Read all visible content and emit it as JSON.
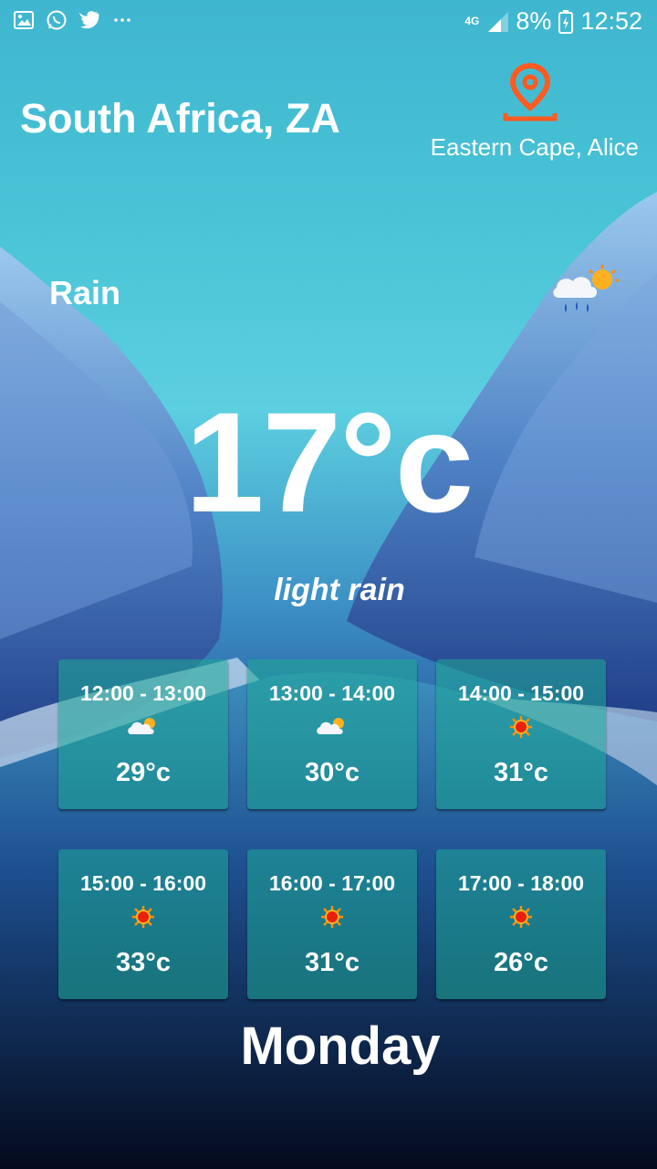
{
  "status_bar": {
    "left_icons": [
      "gallery-icon",
      "whatsapp-icon",
      "twitter-icon",
      "more-dots-icon"
    ],
    "network": "4G",
    "battery": "8%",
    "time": "12:52"
  },
  "location": {
    "country": "South Africa, ZA",
    "region": "Eastern Cape, Alice",
    "pin_icon": "location-pin-icon",
    "accent_color": "#FF5A1F"
  },
  "current": {
    "condition": "Rain",
    "icon": "rain-sun-icon",
    "temperature": "17°c",
    "description": "light rain"
  },
  "hourly": [
    {
      "time": "12:00 - 13:00",
      "icon": "partly-cloudy-icon",
      "temp": "29°c"
    },
    {
      "time": "13:00 - 14:00",
      "icon": "partly-cloudy-icon",
      "temp": "30°c"
    },
    {
      "time": "14:00 - 15:00",
      "icon": "sun-icon",
      "temp": "31°c"
    },
    {
      "time": "15:00 - 16:00",
      "icon": "sun-icon",
      "temp": "33°c"
    },
    {
      "time": "16:00 - 17:00",
      "icon": "sun-icon",
      "temp": "31°c"
    },
    {
      "time": "17:00 - 18:00",
      "icon": "sun-icon",
      "temp": "26°c"
    }
  ],
  "day": "Monday"
}
